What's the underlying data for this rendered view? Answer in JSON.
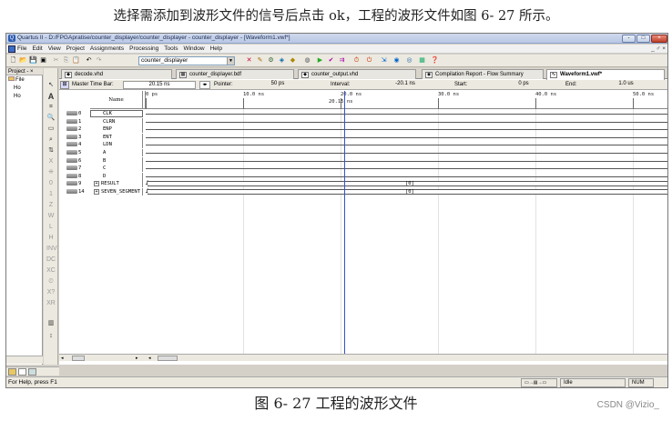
{
  "caption_top": "选择需添加到波形文件的信号后点击 ok，工程的波形文件如图 6- 27 所示。",
  "caption_bottom": "图 6- 27 工程的波形文件",
  "watermark": "CSDN @Vizio_",
  "window": {
    "title": "Quartus II - D:/FPGApratise/counter_displayer/counter_displayer - counter_displayer - [Waveform1.vwf*]",
    "controls": [
      "-",
      "□",
      "×"
    ]
  },
  "menu": {
    "items": [
      "File",
      "Edit",
      "View",
      "Project",
      "Assignments",
      "Processing",
      "Tools",
      "Window",
      "Help"
    ],
    "mdi_controls": "_ ♂ ×"
  },
  "toolbar": {
    "project_combo": "counter_displayer"
  },
  "project_panel": {
    "header": "Project - ×",
    "tree": [
      "File",
      "Ho",
      "Ho"
    ]
  },
  "tabs": [
    {
      "label": "decode.vhd",
      "active": false
    },
    {
      "label": "counter_displayer.bdf",
      "active": false
    },
    {
      "label": "counter_output.vhd",
      "active": false
    },
    {
      "label": "Compilation Report - Flow Summary",
      "active": false
    },
    {
      "label": "Waveform1.vwf*",
      "active": true
    }
  ],
  "timebar": {
    "master_label": "Master Time Bar:",
    "master_value": "20.15 ns",
    "pointer_label": "Pointer:",
    "pointer_value": "50 ps",
    "interval_label": "Interval:",
    "interval_value": "-20.1 ns",
    "start_label": "Start:",
    "start_value": "0 ps",
    "end_label": "End:",
    "end_value": "1.0 us"
  },
  "waveform": {
    "name_header": "Name",
    "ruler_labels": [
      "0 ps",
      "10.0 ns",
      "20.0 ns",
      "30.0 ns",
      "40.0 ns",
      "50.0 ns"
    ],
    "cursor_label": "20.15 ns",
    "signals": [
      {
        "index": "0",
        "name": "CLK"
      },
      {
        "index": "1",
        "name": "CLRN"
      },
      {
        "index": "2",
        "name": "ENP"
      },
      {
        "index": "3",
        "name": "ENT"
      },
      {
        "index": "4",
        "name": "LDN"
      },
      {
        "index": "5",
        "name": "A"
      },
      {
        "index": "6",
        "name": "B"
      },
      {
        "index": "7",
        "name": "C"
      },
      {
        "index": "8",
        "name": "D"
      },
      {
        "index": "9",
        "name": "RESULT",
        "bus": true,
        "value": "[0]"
      },
      {
        "index": "14",
        "name": "SEVEN_SEGMENT",
        "bus": true,
        "value": "[0]"
      }
    ]
  },
  "statusbar": {
    "help_text": "For Help, press F1",
    "state": "Idle",
    "num": "NUM"
  },
  "colors": {
    "cursor": "#3a52c8",
    "titlebar": "#c4d0e6"
  }
}
